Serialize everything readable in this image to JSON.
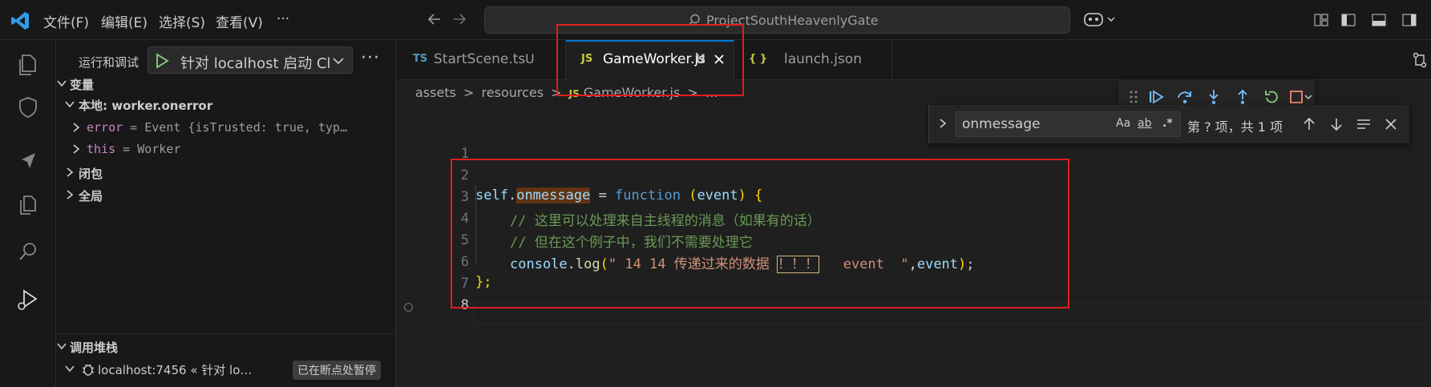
{
  "titlebar": {
    "menus": [
      "文件(F)",
      "编辑(E)",
      "选择(S)",
      "查看(V)",
      "···"
    ],
    "search_text": "ProjectSouthHeavenlyGate"
  },
  "sidebar": {
    "title": "运行和调试",
    "run_config": "针对 localhost 启动 Cl",
    "more": "···",
    "variables_header": "变量",
    "local_scope": "本地: worker.onerror",
    "var_error_name": "error",
    "var_error_eq": " = ",
    "var_error_value": "Event {isTrusted: true, typ…",
    "var_this_name": "this",
    "var_this_eq": " = ",
    "var_this_value": "Worker",
    "closure": "闭包",
    "global": "全局",
    "callstack_header": "调用堆栈",
    "callstack_item": "localhost:7456 « 针对 lo…",
    "callstack_badge": "已在断点处暂停"
  },
  "tabs": [
    {
      "type": "TS",
      "name": "StartScene.ts",
      "mod": "U",
      "active": false
    },
    {
      "type": "JS",
      "name": "GameWorker.js",
      "mod": "U",
      "active": true
    },
    {
      "type": "{ }",
      "name": "launch.json",
      "mod": "",
      "active": false
    }
  ],
  "breadcrumb": {
    "a": "assets",
    "b": "resources",
    "c_type": "JS",
    "c": "GameWorker.js",
    "d": "…",
    "sep": ">"
  },
  "find": {
    "query": "onmessage",
    "opt_case": "Aa",
    "opt_word": "ab",
    "opt_regex": ".*",
    "result": "第 ? 项，共 1 项"
  },
  "editor": {
    "line_numbers": [
      "1",
      "2",
      "3",
      "4",
      "5",
      "6",
      "7",
      "8"
    ],
    "l3_self": "self",
    "l3_dot": ".",
    "l3_onmessage": "onmessage",
    "l3_eq": " = ",
    "l3_function": "function",
    "l3_sp": " ",
    "l3_open": "(",
    "l3_event": "event",
    "l3_close": ")",
    "l3_brace": " {",
    "l4": "// 这里可以处理来自主线程的消息（如果有的话）",
    "l5": "// 但在这个例子中，我们不需要处理它",
    "l6_console": "console",
    "l6_dot": ".",
    "l6_log": "log",
    "l6_open": "(",
    "l6_str1": "\" 14 14 传递过来的数据 ",
    "l6_hl": "！！！",
    "l6_str2": "   event  \"",
    "l6_comma": ",",
    "l6_event": "event",
    "l6_close": ")",
    "l6_semi": ";",
    "l7": "};"
  }
}
